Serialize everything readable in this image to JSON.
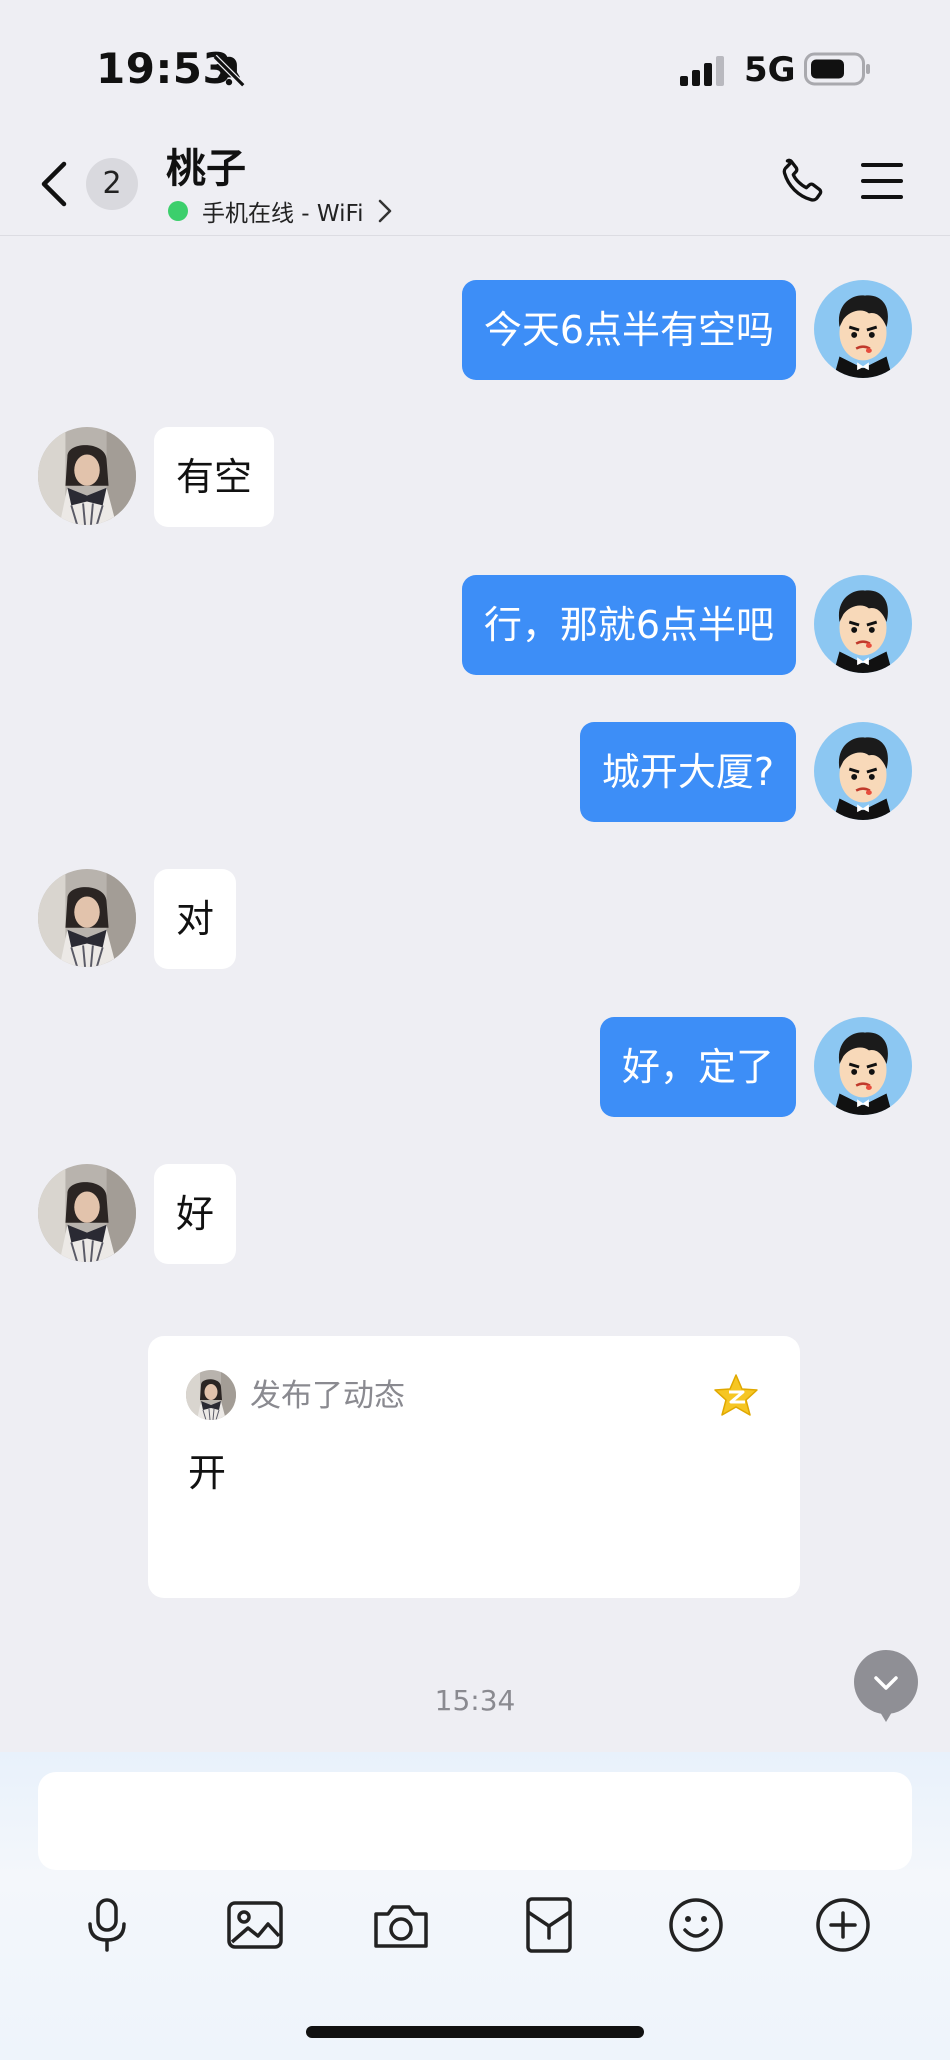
{
  "status_bar": {
    "time": "19:53",
    "network": "5G"
  },
  "header": {
    "unread_count": "2",
    "contact_name": "桃子",
    "online_status": "手机在线 - WiFi"
  },
  "messages": [
    {
      "from": "me",
      "text": "今天6点半有空吗"
    },
    {
      "from": "contact",
      "text": "有空"
    },
    {
      "from": "me",
      "text": "行，那就6点半吧"
    },
    {
      "from": "me",
      "text": "城开大厦?"
    },
    {
      "from": "contact",
      "text": "对"
    },
    {
      "from": "me",
      "text": "好，定了"
    },
    {
      "from": "contact",
      "text": "好"
    }
  ],
  "moment_card": {
    "action": "发布了动态",
    "content": "开"
  },
  "timestamp": "15:34",
  "input": {
    "value": "",
    "placeholder": ""
  },
  "toolbar": [
    "microphone-icon",
    "image-icon",
    "camera-icon",
    "red-packet-icon",
    "emoji-icon",
    "plus-icon"
  ],
  "colors": {
    "outgoing_bubble": "#3d8ef7",
    "incoming_bubble": "#ffffff",
    "background": "#eeeef3",
    "online": "#3ccf6c"
  }
}
